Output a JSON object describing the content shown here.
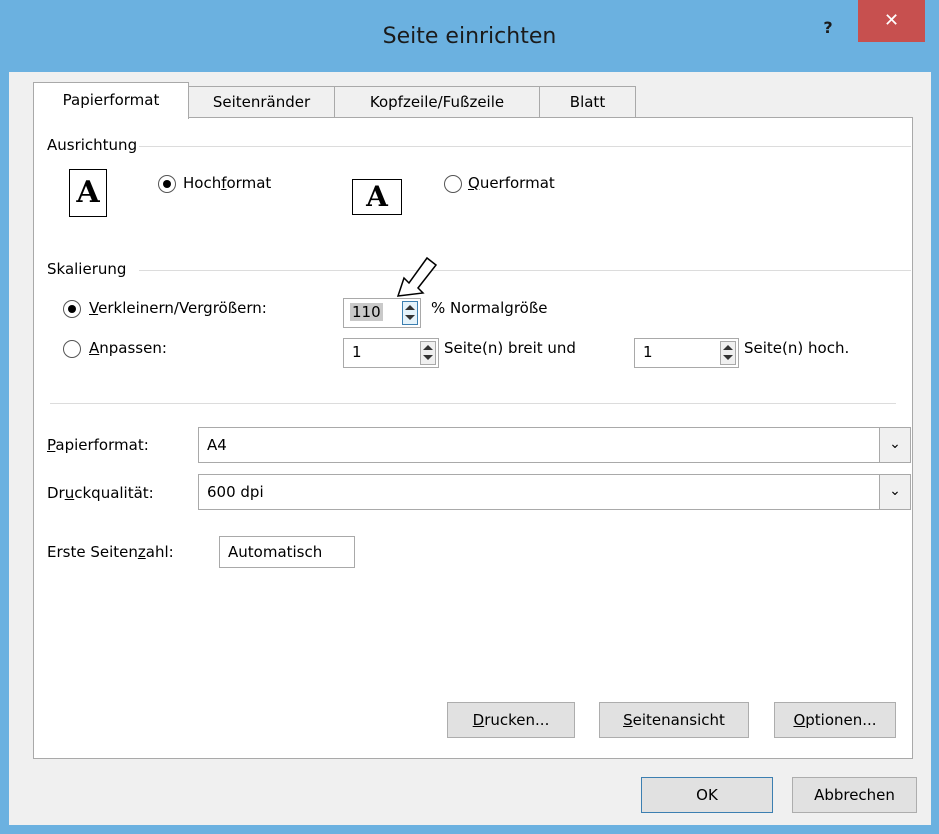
{
  "window": {
    "title": "Seite einrichten",
    "help_label": "?",
    "close_label": "✕"
  },
  "tabs": [
    {
      "label": "Papierformat",
      "active": true
    },
    {
      "label": "Seitenränder",
      "active": false
    },
    {
      "label": "Kopfzeile/Fußzeile",
      "active": false
    },
    {
      "label": "Blatt",
      "active": false
    }
  ],
  "orientation": {
    "group_label": "Ausrichtung",
    "portrait": {
      "pre": "Hoch",
      "accel": "f",
      "post": "ormat",
      "checked": true,
      "icon": "portrait-page-icon",
      "glyph": "A"
    },
    "landscape": {
      "pre": "",
      "accel": "Q",
      "post": "uerformat",
      "checked": false,
      "icon": "landscape-page-icon",
      "glyph": "A"
    }
  },
  "scaling": {
    "group_label": "Skalierung",
    "adjust": {
      "pre": "",
      "accel": "V",
      "post": "erkleinern/Vergrößern:",
      "checked": true,
      "value": "110",
      "suffix": "% Normalgröße"
    },
    "fit": {
      "pre": "",
      "accel": "A",
      "post": "npassen:",
      "checked": false,
      "wide_value": "1",
      "wide_suffix": "Seite(n) breit und",
      "tall_value": "1",
      "tall_suffix": "Seite(n) hoch."
    }
  },
  "paper_size": {
    "pre": "",
    "accel": "P",
    "post": "apierformat:",
    "value": "A4"
  },
  "print_quality": {
    "pre": "Dr",
    "accel": "u",
    "post": "ckqualität:",
    "value": "600 dpi"
  },
  "first_page": {
    "pre": "Erste Seiten",
    "accel": "z",
    "post": "ahl:",
    "value": "Automatisch"
  },
  "panel_buttons": {
    "print": {
      "pre": "",
      "accel": "D",
      "post": "rucken..."
    },
    "preview": {
      "pre": "",
      "accel": "S",
      "post": "eitenansicht"
    },
    "options": {
      "pre": "",
      "accel": "O",
      "post": "ptionen..."
    }
  },
  "footer": {
    "ok_label": "OK",
    "cancel_label": "Abbrechen"
  },
  "colors": {
    "title_bar": "#6bb1e0",
    "close_button": "#c7504f",
    "dialog_background": "#f0f0f0"
  }
}
